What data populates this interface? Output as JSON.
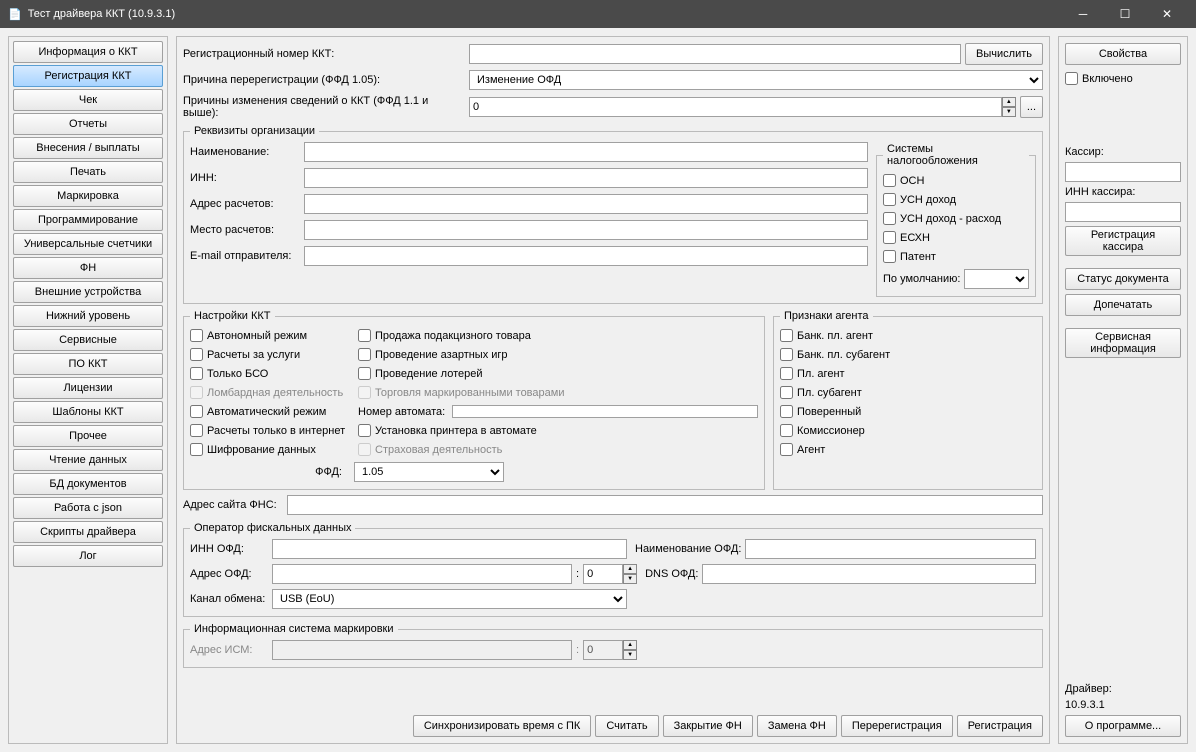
{
  "window": {
    "title": "Тест драйвера ККТ (10.9.3.1)"
  },
  "sidebar": {
    "items": [
      "Информация о ККТ",
      "Регистрация ККТ",
      "Чек",
      "Отчеты",
      "Внесения / выплаты",
      "Печать",
      "Маркировка",
      "Программирование",
      "Универсальные счетчики",
      "ФН",
      "Внешние устройства",
      "Нижний уровень",
      "Сервисные",
      "ПО ККТ",
      "Лицензии",
      "Шаблоны ККТ",
      "Прочее",
      "Чтение данных",
      "БД документов",
      "Работа с json",
      "Скрипты драйвера",
      "Лог"
    ],
    "active_index": 1
  },
  "top": {
    "reg_num_label": "Регистрационный номер ККТ:",
    "reg_num": "",
    "calc": "Вычислить",
    "rereg_reason_label": "Причина перерегистрации (ФФД 1.05):",
    "rereg_reason": "Изменение ОФД",
    "change_reasons_label": "Причины изменения сведений о ККТ (ФФД 1.1 и выше):",
    "change_reasons": "0",
    "more": "..."
  },
  "org": {
    "legend": "Реквизиты организации",
    "name_l": "Наименование:",
    "name": "",
    "inn_l": "ИНН:",
    "inn": "",
    "addr_l": "Адрес расчетов:",
    "addr": "",
    "place_l": "Место расчетов:",
    "place": "",
    "email_l": "E-mail отправителя:",
    "email": "",
    "tax_legend": "Системы налогообложения",
    "tax": [
      "ОСН",
      "УСН доход",
      "УСН доход - расход",
      "ЕСХН",
      "Патент"
    ],
    "default_l": "По умолчанию:",
    "default": ""
  },
  "kkt": {
    "legend": "Настройки ККТ",
    "col1": [
      "Автономный режим",
      "Расчеты за услуги",
      "Только БСО",
      "Ломбардная деятельность",
      "Автоматический режим",
      "Расчеты только в интернет",
      "Шифрование данных"
    ],
    "col1_disabled": [
      false,
      false,
      false,
      true,
      false,
      false,
      false
    ],
    "col2": [
      "Продажа подакцизного товара",
      "Проведение азартных игр",
      "Проведение лотерей",
      "Торговля маркированными товарами",
      "Номер автомата:",
      "Установка принтера в автомате",
      "Страховая деятельность"
    ],
    "col2_disabled": [
      false,
      false,
      false,
      true,
      false,
      false,
      true
    ],
    "ffd_l": "ФФД:",
    "ffd": "1.05",
    "fns_l": "Адрес сайта ФНС:",
    "fns": ""
  },
  "agent": {
    "legend": "Признаки агента",
    "items": [
      "Банк. пл. агент",
      "Банк. пл. субагент",
      "Пл. агент",
      "Пл. субагент",
      "Поверенный",
      "Комиссионер",
      "Агент"
    ]
  },
  "ofd": {
    "legend": "Оператор фискальных данных",
    "inn_l": "ИНН ОФД:",
    "inn": "",
    "name_l": "Наименование ОФД:",
    "name": "",
    "addr_l": "Адрес ОФД:",
    "addr": "",
    "port_sep": ":",
    "port": "0",
    "dns_l": "DNS ОФД:",
    "dns": "",
    "channel_l": "Канал обмена:",
    "channel": "USB (EoU)"
  },
  "ism": {
    "legend": "Информационная система маркировки",
    "addr_l": "Адрес ИСМ:",
    "addr": "",
    "port_sep": ":",
    "port": "0"
  },
  "actions": [
    "Синхронизировать время с ПК",
    "Считать",
    "Закрытие ФН",
    "Замена ФН",
    "Перерегистрация",
    "Регистрация"
  ],
  "right": {
    "props": "Свойства",
    "enabled": "Включено",
    "cashier_l": "Кассир:",
    "cashier": "",
    "cashier_inn_l": "ИНН кассира:",
    "cashier_inn": "",
    "reg_cashier": "Регистрация кассира",
    "doc_status": "Статус документа",
    "reprint": "Допечатать",
    "service_info": "Сервисная информация",
    "driver_l": "Драйвер:",
    "driver_v": "10.9.3.1",
    "about": "О программе..."
  }
}
